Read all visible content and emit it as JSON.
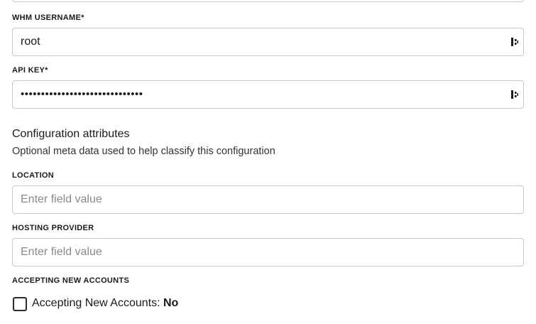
{
  "form": {
    "whm_username": {
      "label": "WHM USERNAME*",
      "value": "root",
      "icon": "password-manager-icon"
    },
    "api_key": {
      "label": "API KEY*",
      "value": "••••••••••••••••••••••••••••••",
      "icon": "password-manager-icon"
    }
  },
  "config_section": {
    "title": "Configuration attributes",
    "description": "Optional meta data used to help classify this configuration"
  },
  "location": {
    "label": "LOCATION",
    "placeholder": "Enter field value"
  },
  "hosting_provider": {
    "label": "HOSTING PROVIDER",
    "placeholder": "Enter field value"
  },
  "accepting_new_accounts": {
    "label": "ACCEPTING NEW ACCOUNTS",
    "checkbox_text": "Accepting New Accounts:",
    "checkbox_value": "No",
    "checked": false
  }
}
